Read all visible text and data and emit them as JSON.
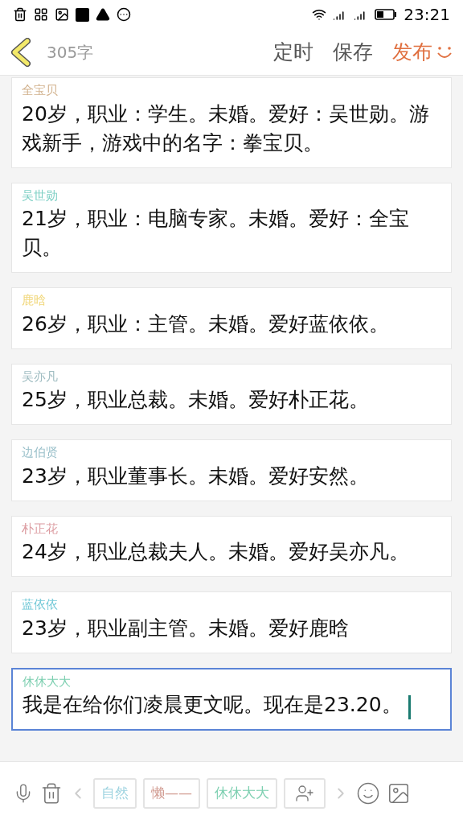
{
  "status_bar": {
    "time": "23:21"
  },
  "header": {
    "word_count": "305字",
    "actions": [
      {
        "label": "定时",
        "kind": "plain"
      },
      {
        "label": "保存",
        "kind": "plain"
      },
      {
        "label": "发布",
        "kind": "publish"
      }
    ]
  },
  "cards": [
    {
      "name": "全宝贝",
      "color": "#d2b28e",
      "text": "20岁，职业：学生。未婚。爱好：吴世勋。游戏新手，游戏中的名字：拳宝贝。",
      "selected": false
    },
    {
      "name": "吴世勋",
      "color": "#7ccfc4",
      "text": "21岁，职业：电脑专家。未婚。爱好：全宝贝。",
      "selected": false
    },
    {
      "name": "鹿晗",
      "color": "#f1d77a",
      "text": "26岁，职业：主管。未婚。爱好蓝依依。",
      "selected": false
    },
    {
      "name": "吴亦凡",
      "color": "#9fbcc1",
      "text": "25岁，职业总裁。未婚。爱好朴正花。",
      "selected": false
    },
    {
      "name": "边伯贤",
      "color": "#98bfc9",
      "text": "23岁，职业董事长。未婚。爱好安然。",
      "selected": false
    },
    {
      "name": "朴正花",
      "color": "#dc9ca1",
      "text": "24岁，职业总裁夫人。未婚。爱好吴亦凡。",
      "selected": false
    },
    {
      "name": "蓝依依",
      "color": "#6ec7d6",
      "text": "23岁，职业副主管。未婚。爱好鹿晗",
      "selected": false
    },
    {
      "name": "休休大大",
      "color": "#7ccfb0",
      "text": "我是在给你们凌晨更文呢。现在是23.20。",
      "selected": true
    }
  ],
  "character_chips": [
    {
      "label": "自然",
      "color": "#9dd3e0"
    },
    {
      "label": "懒——",
      "color": "#d29d93"
    },
    {
      "label": "休休大大",
      "color": "#7ccfb0"
    }
  ]
}
